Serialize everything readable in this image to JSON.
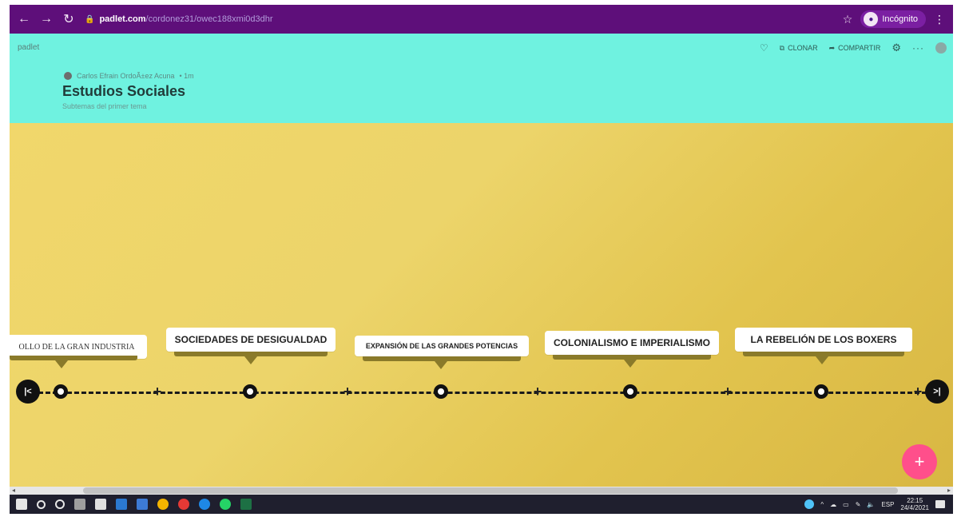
{
  "browser": {
    "url_domain": "padlet.com",
    "url_path": "/cordonez31/owec188xmi0d3dhr",
    "incognito_label": "Incógnito"
  },
  "header": {
    "brand": "padlet",
    "author": "Carlos Efrain OrdoÃ±ez Acuna",
    "time": "• 1m",
    "title": "Estudios Sociales",
    "subtitle": "Subtemas del primer tema",
    "actions": {
      "clone": "CLONAR",
      "share": "COMPARTIR"
    }
  },
  "timeline": {
    "labels": [
      "OLLO DE LA GRAN INDUSTRIA",
      "SOCIEDADES DE DESIGUALDAD",
      "EXPANSIÓN DE LAS GRANDES POTENCIAS",
      "COLONIALISMO E IMPERIALISMO",
      "LA REBELIÓN DE LOS BOXERS"
    ],
    "start_button": "|<",
    "end_button": ">|",
    "add_button": "+"
  },
  "taskbar": {
    "lang": "ESP",
    "time": "22:15",
    "date": "24/4/2021"
  },
  "colors": {
    "header_bg": "#6ff2e0",
    "board_bg": "#ecd46a",
    "fab": "#ff4f8b",
    "chrome": "#5e0f7a"
  }
}
